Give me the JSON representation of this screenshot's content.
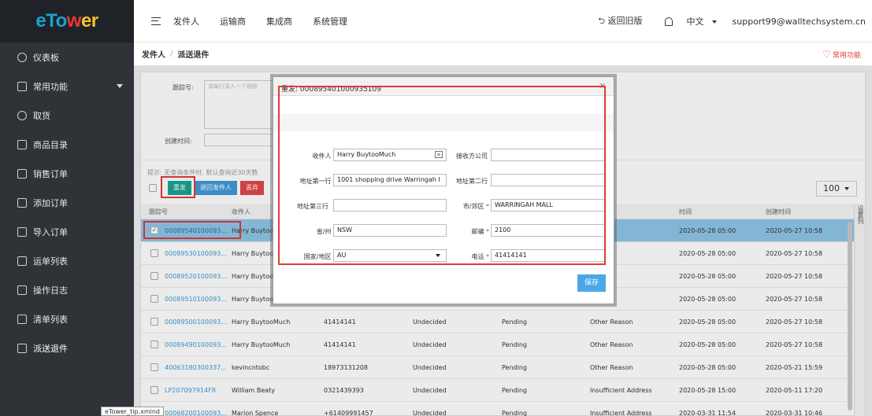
{
  "logo": {
    "e": "e",
    "To": "To",
    "w": "w",
    "er": "er"
  },
  "sidebar": {
    "items": [
      {
        "label": "仪表板"
      },
      {
        "label": "常用功能"
      },
      {
        "label": "取货"
      },
      {
        "label": "商品目录"
      },
      {
        "label": "销售订单"
      },
      {
        "label": "添加订单"
      },
      {
        "label": "导入订单"
      },
      {
        "label": "运单列表"
      },
      {
        "label": "操作日志"
      },
      {
        "label": "清单列表"
      },
      {
        "label": "派送退件"
      }
    ]
  },
  "topbar": {
    "nav": [
      "发件人",
      "运输商",
      "集成商",
      "系统管理"
    ],
    "back_old": "⮌ 返回旧版",
    "lang": "中文",
    "user": "support99@walltechsystem.cn"
  },
  "breadcrumb": {
    "parent": "发件人",
    "sep": "/",
    "current": "派送退件",
    "favorites": "常用功能"
  },
  "filter": {
    "tracking_label": "跟踪号:",
    "tracking_placeholder": "请每行录入一个跟踪",
    "created_label": "创建时间:"
  },
  "hint": "提示: 无查询条件时, 默认查询近30天数",
  "toolbar": {
    "resend": "重发",
    "return_sender": "退回发件人",
    "discard": "丢弃"
  },
  "page_size": "100",
  "table": {
    "headers": {
      "tracking": "跟踪号",
      "recipient": "收件人",
      "time": "时间",
      "created": "创建时间",
      "col_settings": "设置列"
    },
    "rows": [
      {
        "tracking": "00089540100093...",
        "recipient": "Harry Buytoo",
        "phone": "",
        "status1": "",
        "status2": "",
        "reason": "Reason",
        "time": "2020-05-28 05:00",
        "created": "2020-05-27 10:58",
        "selected": true
      },
      {
        "tracking": "00089530100093...",
        "recipient": "Harry Buytoo",
        "phone": "",
        "status1": "",
        "status2": "",
        "reason": "eason",
        "time": "2020-05-28 05:00",
        "created": "2020-05-27 10:58",
        "selected": false
      },
      {
        "tracking": "00089520100093...",
        "recipient": "Harry Buytoo",
        "phone": "",
        "status1": "",
        "status2": "",
        "reason": "eason",
        "time": "2020-05-28 05:00",
        "created": "2020-05-27 10:58",
        "selected": false
      },
      {
        "tracking": "00089510100093...",
        "recipient": "Harry Buytoo",
        "phone": "",
        "status1": "",
        "status2": "",
        "reason": "eason",
        "time": "2020-05-28 05:00",
        "created": "2020-05-27 10:58",
        "selected": false
      },
      {
        "tracking": "00089500100093...",
        "recipient": "Harry BuytooMuch",
        "phone": "41414141",
        "status1": "Undecided",
        "status2": "Pending",
        "reason": "Other Reason",
        "time": "2020-05-28 05:00",
        "created": "2020-05-27 10:58",
        "selected": false
      },
      {
        "tracking": "00089490100093...",
        "recipient": "Harry BuytooMuch",
        "phone": "41414141",
        "status1": "Undecided",
        "status2": "Pending",
        "reason": "Other Reason",
        "time": "2020-05-28 05:00",
        "created": "2020-05-27 10:58",
        "selected": false
      },
      {
        "tracking": "40063180300337...",
        "recipient": "kevincntobc",
        "phone": "18973131208",
        "status1": "Undecided",
        "status2": "Pending",
        "reason": "Other Reason",
        "time": "2020-05-28 05:00",
        "created": "2020-05-21 15:59",
        "selected": false
      },
      {
        "tracking": "LP207097914FR",
        "recipient": "William Beaty",
        "phone": "0321439393",
        "status1": "Undecided",
        "status2": "Pending",
        "reason": "Insufficient Address",
        "time": "2020-05-28 15:00",
        "created": "2020-05-11 17:20",
        "selected": false
      },
      {
        "tracking": "00068200100093...",
        "recipient": "Marion Spence",
        "phone": "+61409991457",
        "status1": "Undecided",
        "status2": "Pending",
        "reason": "Insufficient Address",
        "time": "2020-03-31 11:54",
        "created": "2020-03-31 10:46",
        "selected": false
      }
    ]
  },
  "modal": {
    "title": "重发: 000895401000935109",
    "close": "×",
    "fields": {
      "recipient_label": "收件人",
      "recipient_value": "Harry BuytooMuch",
      "company_label": "接收方公司",
      "company_value": "",
      "addr1_label": "地址第一行",
      "addr1_value": "1001 shopping drive Warringah I",
      "addr2_label": "地址第二行",
      "addr2_value": "",
      "addr3_label": "地址第三行",
      "addr3_value": "",
      "city_label": "市/郊区",
      "city_value": "WARRINGAH MALL",
      "state_label": "省/州",
      "state_value": "NSW",
      "postcode_label": "邮编",
      "postcode_value": "2100",
      "country_label": "国家/地区",
      "country_value": "AU",
      "phone_label": "电话",
      "phone_value": "41414141"
    },
    "required_mark": "*",
    "save": "保存"
  },
  "tooltip": "eTower_tip.xmind"
}
